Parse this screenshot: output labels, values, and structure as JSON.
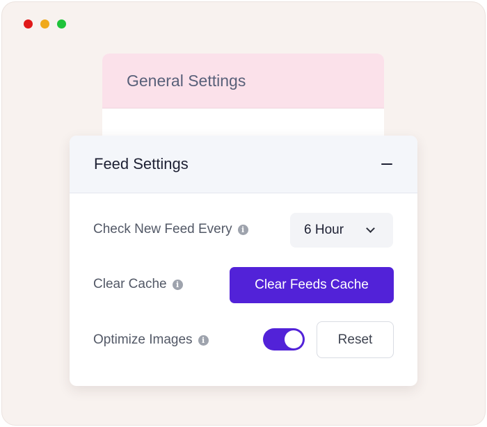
{
  "window": {
    "controls": [
      "close",
      "minimize",
      "maximize"
    ]
  },
  "general_settings": {
    "title": "General Settings"
  },
  "feed_settings": {
    "title": "Feed Settings",
    "collapse_icon": "minus-icon",
    "check_feed": {
      "label": "Check New Feed Every",
      "selected": "6 Hour"
    },
    "clear_cache": {
      "label": "Clear Cache",
      "button_label": "Clear Feeds Cache"
    },
    "optimize_images": {
      "label": "Optimize Images",
      "enabled": true,
      "reset_label": "Reset"
    }
  },
  "colors": {
    "accent": "#5222d8",
    "pink_header": "#fbe1ea",
    "window_bg": "#f8f2ef"
  }
}
